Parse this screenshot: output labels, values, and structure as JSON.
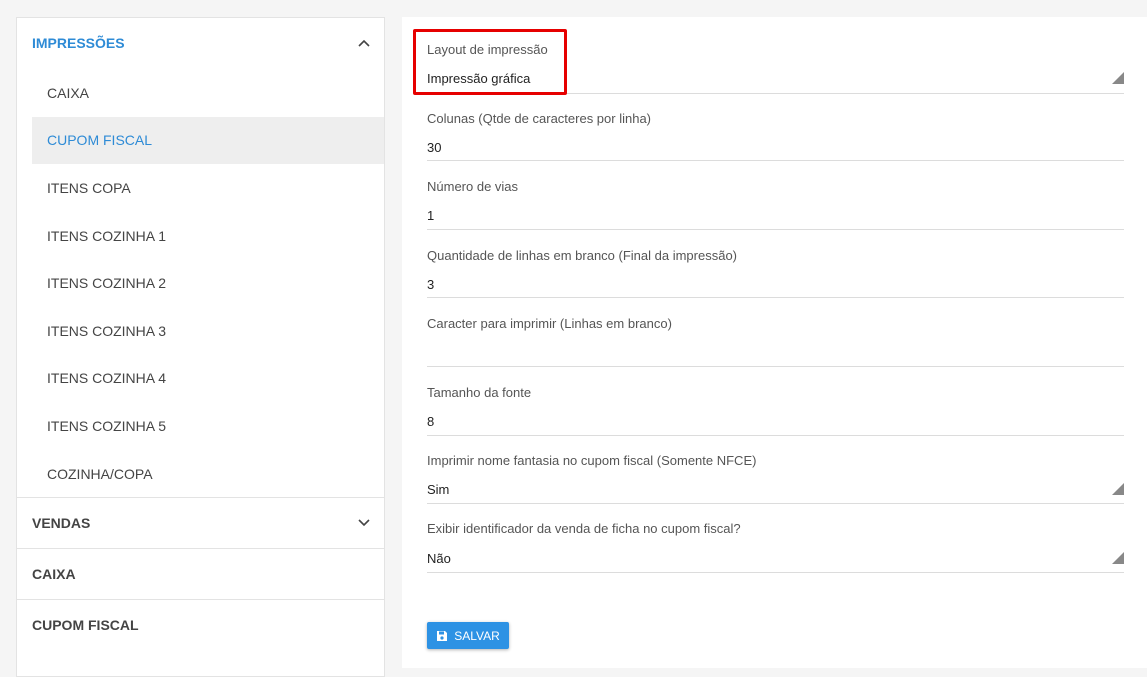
{
  "sidebar": {
    "sections": [
      {
        "label": "IMPRESSÕES",
        "expanded": true
      },
      {
        "label": "VENDAS",
        "expanded": false
      },
      {
        "label": "CAIXA"
      },
      {
        "label": "CUPOM FISCAL"
      }
    ],
    "sub_items": [
      "CAIXA",
      "CUPOM FISCAL",
      "ITENS COPA",
      "ITENS COZINHA 1",
      "ITENS COZINHA 2",
      "ITENS COZINHA 3",
      "ITENS COZINHA 4",
      "ITENS COZINHA 5",
      "COZINHA/COPA"
    ],
    "selected_item": "CUPOM FISCAL"
  },
  "form": {
    "fields": [
      {
        "label": "Layout de impressão",
        "value": "Impressão gráfica",
        "type": "select"
      },
      {
        "label": "Colunas (Qtde de caracteres por linha)",
        "value": "30",
        "type": "input"
      },
      {
        "label": "Número de vias",
        "value": "1",
        "type": "input"
      },
      {
        "label": "Quantidade de linhas em branco (Final da impressão)",
        "value": "3",
        "type": "input"
      },
      {
        "label": "Caracter para imprimir (Linhas em branco)",
        "value": "",
        "type": "input"
      },
      {
        "label": "Tamanho da fonte",
        "value": "8",
        "type": "input"
      },
      {
        "label": "Imprimir nome fantasia no cupom fiscal (Somente NFCE)",
        "value": "Sim",
        "type": "select"
      },
      {
        "label": "Exibir identificador da venda de ficha no cupom fiscal?",
        "value": "Não",
        "type": "select"
      }
    ],
    "save_label": "SALVAR"
  },
  "colors": {
    "accent": "#2e8bd6",
    "button": "#2d92e4",
    "highlight": "#e60000"
  }
}
